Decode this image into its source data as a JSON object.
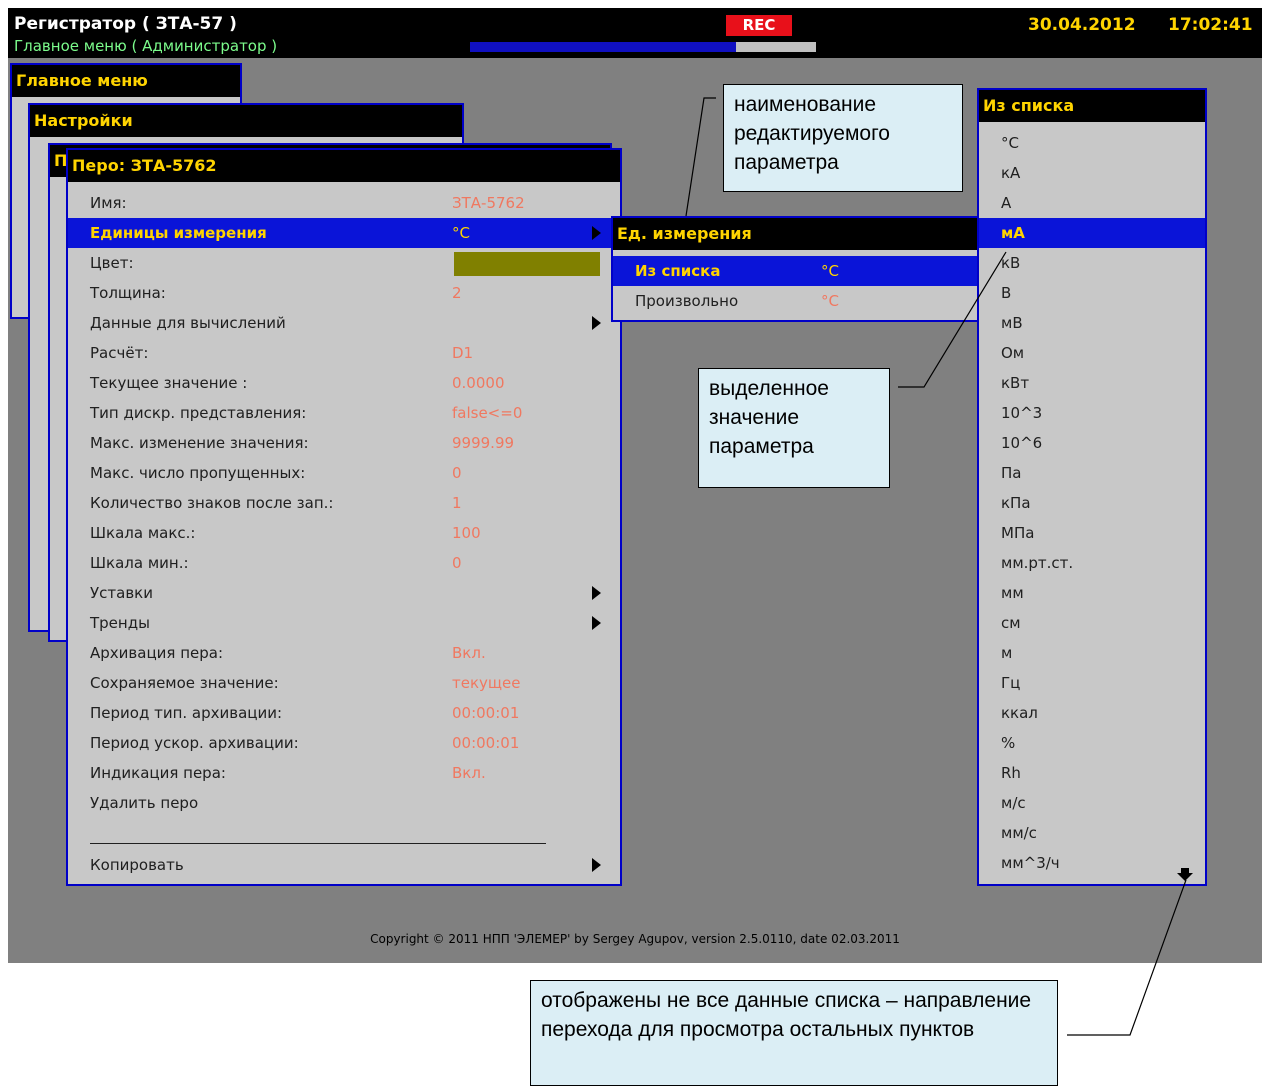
{
  "topbar": {
    "title": "Регистратор ( ЗТА-57 )",
    "subtitle": "Главное меню ( Администратор )",
    "rec": "REC",
    "progress": 0.77,
    "date": "30.04.2012",
    "time": "17:02:41"
  },
  "windows": {
    "main": "Главное меню",
    "settings": "Настройки",
    "hidden_initial": "П",
    "pen": "Перо: ЗТА-5762"
  },
  "pen_rows": [
    {
      "label": "Имя:",
      "value": "ЗТА-5762",
      "arrow": false
    },
    {
      "label": "Единицы измерения",
      "value": "°C",
      "arrow": true
    },
    {
      "label": "Цвет:",
      "value": "",
      "arrow": false
    },
    {
      "label": "Толщина:",
      "value": "2",
      "arrow": false
    },
    {
      "label": "Данные для вычислений",
      "value": "",
      "arrow": true
    },
    {
      "label": "Расчёт:",
      "value": "D1",
      "arrow": false
    },
    {
      "label": "Текущее значение :",
      "value": "0.0000",
      "arrow": false
    },
    {
      "label": "Тип дискр. представления:",
      "value": "false<=0",
      "arrow": false
    },
    {
      "label": "Макс. изменение значения:",
      "value": "9999.99",
      "arrow": false
    },
    {
      "label": "Макс. число пропущенных:",
      "value": "0",
      "arrow": false
    },
    {
      "label": "Количество знаков после зап.:",
      "value": "1",
      "arrow": false
    },
    {
      "label": "Шкала макс.:",
      "value": "100",
      "arrow": false
    },
    {
      "label": "Шкала мин.:",
      "value": "0",
      "arrow": false
    },
    {
      "label": "Уставки",
      "value": "",
      "arrow": true
    },
    {
      "label": "Тренды",
      "value": "",
      "arrow": true
    },
    {
      "label": "Архивация пера:",
      "value": "Вкл.",
      "arrow": false
    },
    {
      "label": "Сохраняемое значение:",
      "value": "текущее",
      "arrow": false
    },
    {
      "label": "Период тип. архивации:",
      "value": "00:00:01",
      "arrow": false
    },
    {
      "label": "Период ускор. архивации:",
      "value": "00:00:01",
      "arrow": false
    },
    {
      "label": "Индикация пера:",
      "value": "Вкл.",
      "arrow": false
    },
    {
      "label": "Удалить перо",
      "value": "",
      "arrow": false
    }
  ],
  "pen_copy": "Копировать",
  "pen_color": "#808000",
  "units_window": {
    "title": "Ед. измерения",
    "rows": [
      {
        "label": "Из списка",
        "value": "°C"
      },
      {
        "label": "Произвольно",
        "value": "°C"
      }
    ]
  },
  "list_window": {
    "title": "Из списка",
    "selected_index": 3,
    "items": [
      "°C",
      "кА",
      "А",
      "мА",
      "кВ",
      "В",
      "мВ",
      "Ом",
      "кВт",
      "10^3",
      "10^6",
      "Па",
      "кПа",
      "МПа",
      "мм.рт.ст.",
      "мм",
      "см",
      "м",
      "Гц",
      "ккал",
      "%",
      "Rh",
      "м/с",
      "мм/с",
      "мм^3/ч"
    ]
  },
  "footer": "Copyright © 2011 НПП 'ЭЛЕМЕР' by Sergey Agupov, version 2.5.0110, date 02.03.2011",
  "callouts": {
    "param_name": "наименование редактируемого параметра",
    "selected_value": "выделенное значение параметра",
    "more_items": "отображены не все данные списка – направление перехода для просмотра остальных пунктов"
  }
}
